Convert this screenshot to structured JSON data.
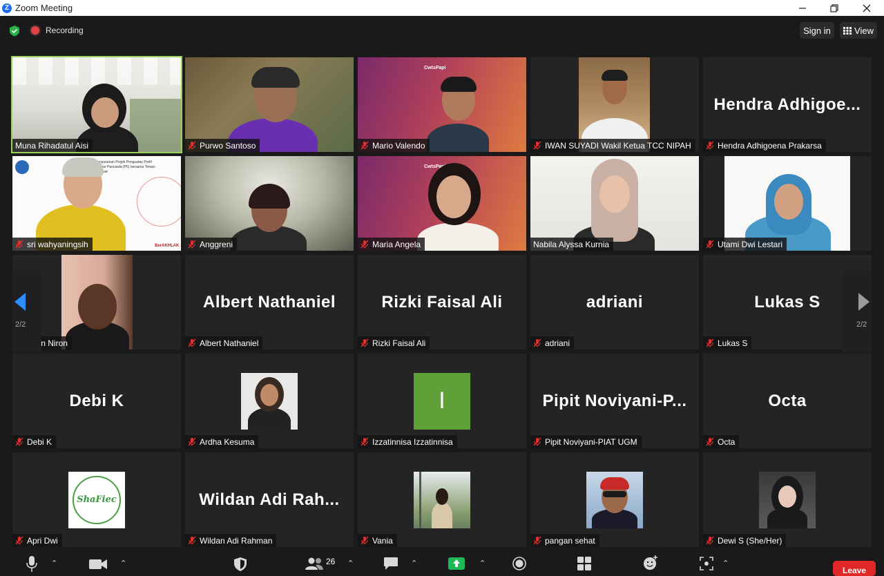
{
  "window": {
    "title": "Zoom Meeting"
  },
  "topbar": {
    "recording_label": "Recording",
    "signin_label": "Sign in",
    "view_label": "View"
  },
  "pager": {
    "left_label": "2/2",
    "right_label": "2/2"
  },
  "tiles": [
    {
      "name": "Muna Rihadatul Aisi",
      "big": ""
    },
    {
      "name": "Purwo Santoso",
      "big": ""
    },
    {
      "name": "Mario Valendo",
      "big": ""
    },
    {
      "name": "IWAN SUYADI Wakil Ketua TCC NIPAH",
      "big": ""
    },
    {
      "name": "Hendra Adhigoena Prakarsa",
      "big": "Hendra  Adhigoe..."
    },
    {
      "name": "sri wahyaningsih",
      "big": ""
    },
    {
      "name": "Anggreni",
      "big": ""
    },
    {
      "name": "Maria Angela",
      "big": ""
    },
    {
      "name": "Nabila Alyssa Kurnia",
      "big": ""
    },
    {
      "name": "Utami Dwi Lestari",
      "big": ""
    },
    {
      "name": "Yoan Niron",
      "big": ""
    },
    {
      "name": "Albert Nathaniel",
      "big": "Albert Nathaniel"
    },
    {
      "name": "Rizki Faisal Ali",
      "big": "Rizki Faisal Ali"
    },
    {
      "name": "adriani",
      "big": "adriani"
    },
    {
      "name": "Lukas S",
      "big": "Lukas S"
    },
    {
      "name": "Debi K",
      "big": "Debi K"
    },
    {
      "name": "Ardha Kesuma",
      "big": ""
    },
    {
      "name": "Izzatinnisa Izzatinnisa",
      "big": "",
      "avatar_letter": "I"
    },
    {
      "name": "Pipit Noviyani-PIAT UGM",
      "big": "Pipit  Noviyani-P..."
    },
    {
      "name": "Octa",
      "big": "Octa"
    },
    {
      "name": "Apri Dwi",
      "big": "",
      "logo_text": "ShaFiec"
    },
    {
      "name": "Wildan Adi Rahman",
      "big": "Wildan  Adi  Rah..."
    },
    {
      "name": "Vania",
      "big": ""
    },
    {
      "name": "pangan sehat",
      "big": ""
    },
    {
      "name": "Dewi S (She/Her)",
      "big": ""
    }
  ],
  "slides": {
    "cwtn": "CwtsPapi",
    "profil_text": "Penyusunan Projek Penguatan Profil Pelajar Pancasila (P5) bersama Teman Sejawat",
    "berakhlak": "BerAKHLAK"
  },
  "toolbar": {
    "participants_count": "26",
    "leave_label": "Leave"
  },
  "colors": {
    "active_speaker": "#9bd15a",
    "leave": "#e02828",
    "share": "#1db954",
    "zoom_blue": "#1f6cf5"
  }
}
